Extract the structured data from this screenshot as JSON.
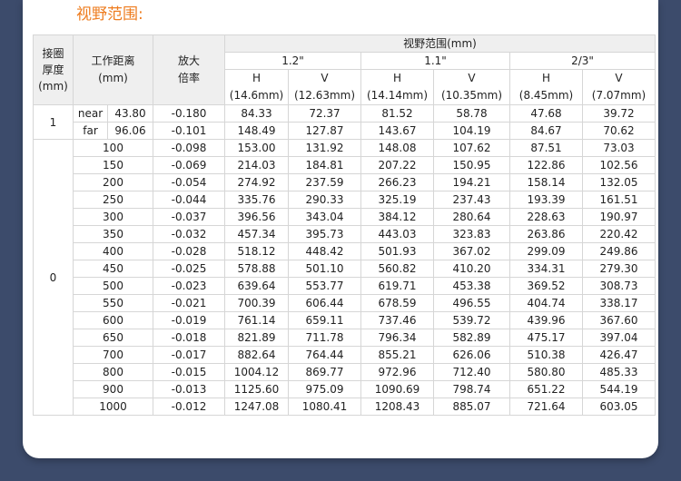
{
  "title": "视野范围:",
  "header": {
    "thickness": "接圈\n厚度\n(mm)",
    "wd": "工作距离\n(mm)",
    "mag": "放大\n倍率",
    "fov": "视野范围(mm)",
    "sensors": [
      "1.2\"",
      "1.1\"",
      "2/3\""
    ],
    "subs": [
      "H\n(14.6mm)",
      "V\n(12.63mm)",
      "H\n(14.14mm)",
      "V\n(10.35mm)",
      "H\n(8.45mm)",
      "V\n(7.07mm)"
    ]
  },
  "ring1": {
    "label": "1",
    "rows": [
      {
        "tag": "near",
        "wd": "43.80",
        "mag": "-0.180",
        "vals": [
          "84.33",
          "72.37",
          "81.52",
          "58.78",
          "47.68",
          "39.72"
        ]
      },
      {
        "tag": "far",
        "wd": "96.06",
        "mag": "-0.101",
        "vals": [
          "148.49",
          "127.87",
          "143.67",
          "104.19",
          "84.67",
          "70.62"
        ]
      }
    ]
  },
  "ring0": {
    "label": "0",
    "rows": [
      {
        "wd": "100",
        "mag": "-0.098",
        "vals": [
          "153.00",
          "131.92",
          "148.08",
          "107.62",
          "87.51",
          "73.03"
        ]
      },
      {
        "wd": "150",
        "mag": "-0.069",
        "vals": [
          "214.03",
          "184.81",
          "207.22",
          "150.95",
          "122.86",
          "102.56"
        ]
      },
      {
        "wd": "200",
        "mag": "-0.054",
        "vals": [
          "274.92",
          "237.59",
          "266.23",
          "194.21",
          "158.14",
          "132.05"
        ]
      },
      {
        "wd": "250",
        "mag": "-0.044",
        "vals": [
          "335.76",
          "290.33",
          "325.19",
          "237.43",
          "193.39",
          "161.51"
        ]
      },
      {
        "wd": "300",
        "mag": "-0.037",
        "vals": [
          "396.56",
          "343.04",
          "384.12",
          "280.64",
          "228.63",
          "190.97"
        ]
      },
      {
        "wd": "350",
        "mag": "-0.032",
        "vals": [
          "457.34",
          "395.73",
          "443.03",
          "323.83",
          "263.86",
          "220.42"
        ]
      },
      {
        "wd": "400",
        "mag": "-0.028",
        "vals": [
          "518.12",
          "448.42",
          "501.93",
          "367.02",
          "299.09",
          "249.86"
        ]
      },
      {
        "wd": "450",
        "mag": "-0.025",
        "vals": [
          "578.88",
          "501.10",
          "560.82",
          "410.20",
          "334.31",
          "279.30"
        ]
      },
      {
        "wd": "500",
        "mag": "-0.023",
        "vals": [
          "639.64",
          "553.77",
          "619.71",
          "453.38",
          "369.52",
          "308.73"
        ]
      },
      {
        "wd": "550",
        "mag": "-0.021",
        "vals": [
          "700.39",
          "606.44",
          "678.59",
          "496.55",
          "404.74",
          "338.17"
        ]
      },
      {
        "wd": "600",
        "mag": "-0.019",
        "vals": [
          "761.14",
          "659.11",
          "737.46",
          "539.72",
          "439.96",
          "367.60"
        ]
      },
      {
        "wd": "650",
        "mag": "-0.018",
        "vals": [
          "821.89",
          "711.78",
          "796.34",
          "582.89",
          "475.17",
          "397.04"
        ]
      },
      {
        "wd": "700",
        "mag": "-0.017",
        "vals": [
          "882.64",
          "764.44",
          "855.21",
          "626.06",
          "510.38",
          "426.47"
        ]
      },
      {
        "wd": "800",
        "mag": "-0.015",
        "vals": [
          "1004.12",
          "869.77",
          "972.96",
          "712.40",
          "580.80",
          "485.33"
        ]
      },
      {
        "wd": "900",
        "mag": "-0.013",
        "vals": [
          "1125.60",
          "975.09",
          "1090.69",
          "798.74",
          "651.22",
          "544.19"
        ]
      },
      {
        "wd": "1000",
        "mag": "-0.012",
        "vals": [
          "1247.08",
          "1080.41",
          "1208.43",
          "885.07",
          "721.64",
          "603.05"
        ]
      }
    ]
  }
}
